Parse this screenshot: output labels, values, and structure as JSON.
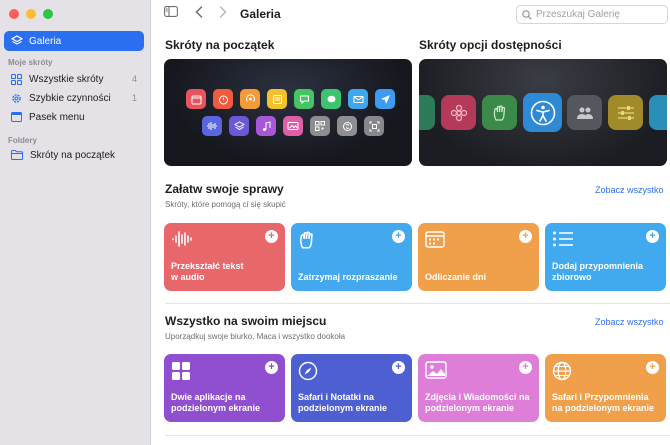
{
  "window": {
    "title": "Galeria"
  },
  "sidebar": {
    "active": {
      "label": "Galeria"
    },
    "section_my": "Moje skróty",
    "items": [
      {
        "label": "Wszystkie skróty",
        "count": "4"
      },
      {
        "label": "Szybkie czynności",
        "count": "1"
      },
      {
        "label": "Pasek menu",
        "count": ""
      }
    ],
    "section_folders": "Foldery",
    "folders": [
      {
        "label": "Skróty na początek"
      }
    ]
  },
  "toolbar": {
    "search_placeholder": "Przeszukaj Galerię"
  },
  "main": {
    "section1_title": "Skróty na początek",
    "section2_title": "Skróty opcji dostępności",
    "section3": {
      "title": "Załatw swoje sprawy",
      "subtitle": "Skróty, które pomogą ci się skupić",
      "see_all": "Zobacz wszystko"
    },
    "section3_cards": [
      {
        "label": "Przekształć tekst\nw audio",
        "color": "#e8676b"
      },
      {
        "label": "Zatrzymaj rozpraszanie",
        "color": "#44a8ee"
      },
      {
        "label": "Odliczanie dni",
        "color": "#f0a04b"
      },
      {
        "label": "Dodaj przypomnienia\nzbiorowo",
        "color": "#41a9ee"
      }
    ],
    "section4": {
      "title": "Wszystko na swoim miejscu",
      "subtitle": "Uporządkuj swoje biurko, Maca i wszystko dookoła",
      "see_all": "Zobacz wszystko"
    },
    "section4_cards": [
      {
        "label": "Dwie aplikacje na\npodzielonym ekranie",
        "color": "#8f4fcf"
      },
      {
        "label": "Safari i Notatki na\npodzielonym ekranie",
        "color": "#4d5fd1"
      },
      {
        "label": "Zdjęcia i Wiadomości na\npodzielonym ekranie",
        "color": "#de7ed8"
      },
      {
        "label": "Safari i Przypomnienia\nna podzielonym ekranie",
        "color": "#f0a04b"
      }
    ]
  }
}
